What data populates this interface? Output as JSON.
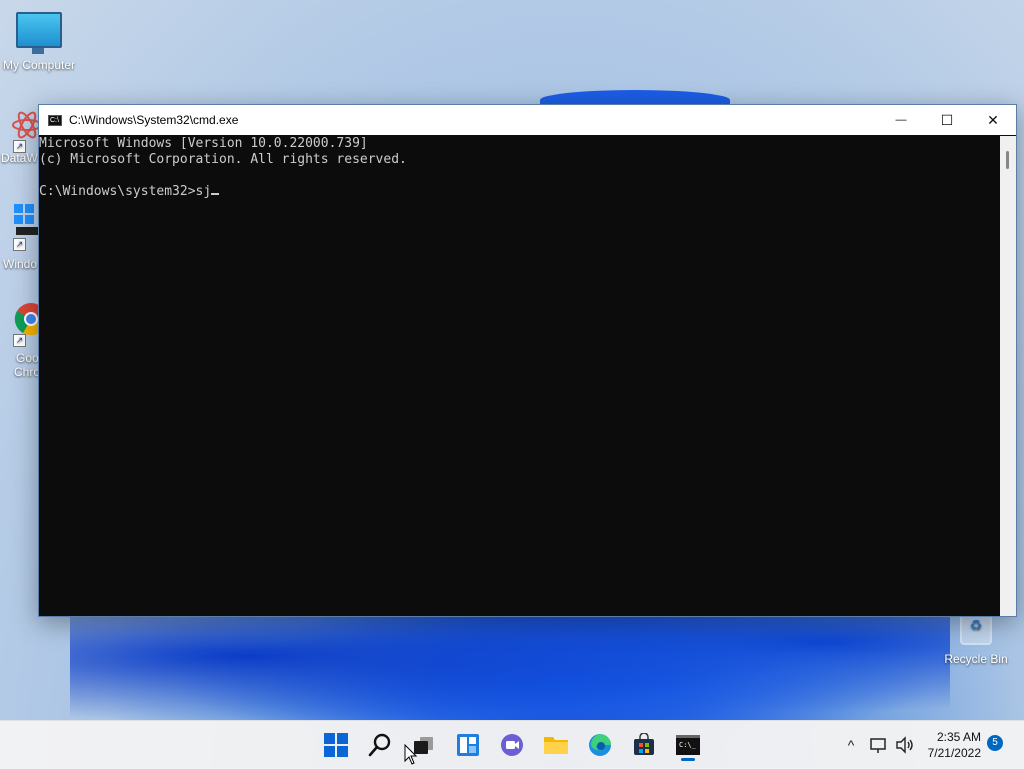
{
  "desktop": {
    "icons": [
      {
        "label": "My Computer"
      },
      {
        "label": "DataW"
      },
      {
        "label": "Windo"
      },
      {
        "label": "Goo",
        "label2": "Chro"
      }
    ],
    "recycle_bin": {
      "label": "Recycle Bin"
    }
  },
  "window": {
    "title": "C:\\Windows\\System32\\cmd.exe",
    "minimize_glyph": "—",
    "maximize_glyph": "☐",
    "close_glyph": "✕",
    "console_lines": [
      "Microsoft Windows [Version 10.0.22000.739]",
      "(c) Microsoft Corporation. All rights reserved.",
      "",
      "C:\\Windows\\system32>sj"
    ]
  },
  "taskbar": {
    "apps": [
      {
        "name": "Start",
        "icon": "windows-logo-icon"
      },
      {
        "name": "Search",
        "icon": "search-icon"
      },
      {
        "name": "Task View",
        "icon": "task-view-icon"
      },
      {
        "name": "Widgets",
        "icon": "widgets-icon"
      },
      {
        "name": "Chat",
        "icon": "chat-icon"
      },
      {
        "name": "File Explorer",
        "icon": "folder-icon"
      },
      {
        "name": "Microsoft Edge",
        "icon": "edge-icon"
      },
      {
        "name": "Microsoft Store",
        "icon": "store-icon"
      },
      {
        "name": "Command Prompt",
        "icon": "terminal-icon"
      }
    ],
    "tray": {
      "chevron": "^",
      "time": "2:35 AM",
      "date": "7/21/2022",
      "notifications": "5"
    }
  },
  "colors": {
    "accent": "#0067c0",
    "console_bg": "#0c0c0c",
    "console_fg": "#cccccc"
  }
}
